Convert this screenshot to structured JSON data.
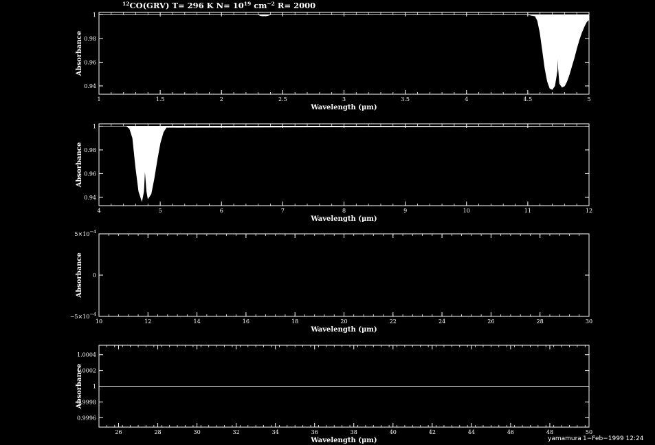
{
  "figure": {
    "title": {
      "iso_superscript": "12",
      "part1": "CO(GRV) T= 296 K N= 10",
      "n_exp": "19",
      "part2": " cm",
      "cm_exp": "−2",
      "part3": " R= 2000"
    },
    "footer": {
      "user": "yamamura",
      "date": "1−Feb−1999 12:24"
    },
    "colors": {
      "background": "#000000",
      "foreground": "#ffffff"
    }
  },
  "chart_data": [
    {
      "type": "area",
      "xlabel": "Wavelength (μm)",
      "ylabel": "Absorbance",
      "xlim": [
        1,
        5
      ],
      "ylim": [
        0.933,
        1.002
      ],
      "xticks": [
        1,
        1.5,
        2,
        2.5,
        3,
        3.5,
        4,
        4.5,
        5
      ],
      "xtick_labels": [
        "1",
        "1.5",
        "2",
        "2.5",
        "3",
        "3.5",
        "4",
        "4.5",
        "5"
      ],
      "yticks": [
        0.94,
        0.96,
        0.98,
        1
      ],
      "ytick_labels": [
        "0.94",
        "0.96",
        "0.98",
        "1"
      ],
      "series": [
        {
          "x": [
            1.0,
            2.3,
            2.32,
            2.34,
            2.35,
            2.36,
            2.38,
            2.4,
            4.5,
            4.56,
            4.58,
            4.6,
            4.62,
            4.64,
            4.66,
            4.68,
            4.7,
            4.72,
            4.74,
            4.745,
            4.75,
            4.76,
            4.78,
            4.8,
            4.82,
            4.84,
            4.86,
            4.88,
            4.9,
            4.92,
            4.94,
            4.96,
            4.98,
            5.0
          ],
          "y": [
            1.0,
            1.0,
            0.9993,
            0.999,
            0.9992,
            0.999,
            0.9994,
            1.0,
            1.0,
            0.999,
            0.995,
            0.985,
            0.97,
            0.955,
            0.944,
            0.938,
            0.937,
            0.94,
            0.953,
            0.97,
            0.955,
            0.942,
            0.939,
            0.94,
            0.944,
            0.95,
            0.957,
            0.964,
            0.972,
            0.979,
            0.985,
            0.99,
            0.994,
            0.996
          ]
        }
      ]
    },
    {
      "type": "area",
      "xlabel": "Wavelength (μm)",
      "ylabel": "Absorbance",
      "xlim": [
        4,
        12
      ],
      "ylim": [
        0.933,
        1.002
      ],
      "xticks": [
        4,
        5,
        6,
        7,
        8,
        9,
        10,
        11,
        12
      ],
      "xtick_labels": [
        "4",
        "5",
        "6",
        "7",
        "8",
        "9",
        "10",
        "11",
        "12"
      ],
      "yticks": [
        0.94,
        0.96,
        0.98,
        1
      ],
      "ytick_labels": [
        "0.94",
        "0.96",
        "0.98",
        "1"
      ],
      "series": [
        {
          "x": [
            4.0,
            4.45,
            4.5,
            4.55,
            4.6,
            4.65,
            4.7,
            4.73,
            4.75,
            4.78,
            4.8,
            4.85,
            4.9,
            4.95,
            5.0,
            5.05,
            5.1,
            12.0
          ],
          "y": [
            1.0,
            1.0,
            0.998,
            0.99,
            0.965,
            0.945,
            0.937,
            0.945,
            0.965,
            0.945,
            0.939,
            0.943,
            0.956,
            0.972,
            0.986,
            0.995,
            0.999,
            1.0
          ]
        }
      ]
    },
    {
      "type": "line",
      "xlabel": "Wavelength (μm)",
      "ylabel": "Absorbance",
      "xlim": [
        10,
        30
      ],
      "ylim": [
        -0.0005,
        0.0005
      ],
      "xticks": [
        10,
        12,
        14,
        16,
        18,
        20,
        22,
        24,
        26,
        28,
        30
      ],
      "xtick_labels": [
        "10",
        "12",
        "14",
        "16",
        "18",
        "20",
        "22",
        "24",
        "26",
        "28",
        "30"
      ],
      "yticks": [
        -0.0005,
        0,
        0.0005
      ],
      "ytick_labels": [
        "−5×10",
        "0",
        "5×10"
      ],
      "ytick_exps": [
        "−4",
        "",
        "−4"
      ],
      "series": []
    },
    {
      "type": "line",
      "xlabel": "Wavelength (μm)",
      "ylabel": "Absorbance",
      "xlim": [
        25,
        50
      ],
      "ylim": [
        0.99948,
        1.00052
      ],
      "xticks": [
        26,
        28,
        30,
        32,
        34,
        36,
        38,
        40,
        42,
        44,
        46,
        48,
        50
      ],
      "xtick_labels": [
        "26",
        "28",
        "30",
        "32",
        "34",
        "36",
        "38",
        "40",
        "42",
        "44",
        "46",
        "48",
        "50"
      ],
      "yticks": [
        0.9996,
        0.9998,
        1,
        1.0002,
        1.0004
      ],
      "ytick_labels": [
        "0.9996",
        "0.9998",
        "1",
        "1.0002",
        "1.0004"
      ],
      "series": [
        {
          "x": [
            25,
            50
          ],
          "y": [
            1,
            1
          ]
        }
      ]
    }
  ]
}
